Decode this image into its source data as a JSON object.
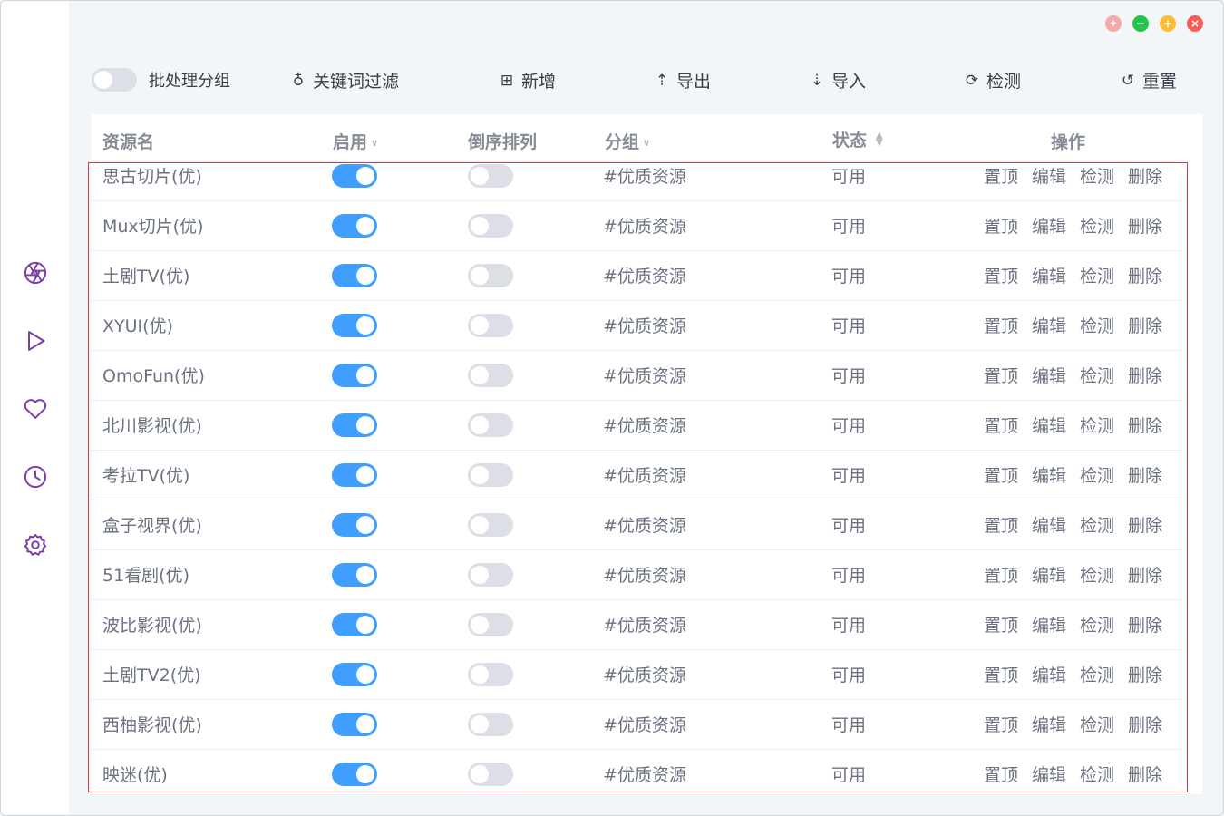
{
  "window": {
    "controls": {
      "pin": "✦",
      "min": "−",
      "max": "+",
      "close": "×"
    }
  },
  "sidebar": {
    "icons": [
      "aperture-icon",
      "play-icon",
      "heart-icon",
      "clock-icon",
      "gear-icon"
    ]
  },
  "toolbar": {
    "batch_label": "批处理分组",
    "keyword_filter": "关键词过滤",
    "add": "新增",
    "export": "导出",
    "import": "导入",
    "check": "检测",
    "reset": "重置",
    "icons": {
      "keyword_filter": "♁",
      "add": "⊞",
      "export": "⇡",
      "import": "⇣",
      "check": "⟳",
      "reset": "↺"
    }
  },
  "table": {
    "headers": {
      "name": "资源名",
      "enabled": "启用",
      "reverse": "倒序排列",
      "group": "分组",
      "status": "状态",
      "actions": "操作"
    },
    "rows": [
      {
        "name": "思古切片(优)",
        "group": "#优质资源",
        "status": "可用"
      },
      {
        "name": "Mux切片(优)",
        "group": "#优质资源",
        "status": "可用"
      },
      {
        "name": "土剧TV(优)",
        "group": "#优质资源",
        "status": "可用"
      },
      {
        "name": "XYUI(优)",
        "group": "#优质资源",
        "status": "可用"
      },
      {
        "name": "OmoFun(优)",
        "group": "#优质资源",
        "status": "可用"
      },
      {
        "name": "北川影视(优)",
        "group": "#优质资源",
        "status": "可用"
      },
      {
        "name": "考拉TV(优)",
        "group": "#优质资源",
        "status": "可用"
      },
      {
        "name": "盒子视界(优)",
        "group": "#优质资源",
        "status": "可用"
      },
      {
        "name": "51看剧(优)",
        "group": "#优质资源",
        "status": "可用"
      },
      {
        "name": "波比影视(优)",
        "group": "#优质资源",
        "status": "可用"
      },
      {
        "name": "土剧TV2(优)",
        "group": "#优质资源",
        "status": "可用"
      },
      {
        "name": "西柚影视(优)",
        "group": "#优质资源",
        "status": "可用"
      },
      {
        "name": "映迷(优)",
        "group": "#优质资源",
        "status": "可用"
      }
    ],
    "row_actions": {
      "top": "置顶",
      "edit": "编辑",
      "check": "检测",
      "delete": "删除"
    }
  }
}
